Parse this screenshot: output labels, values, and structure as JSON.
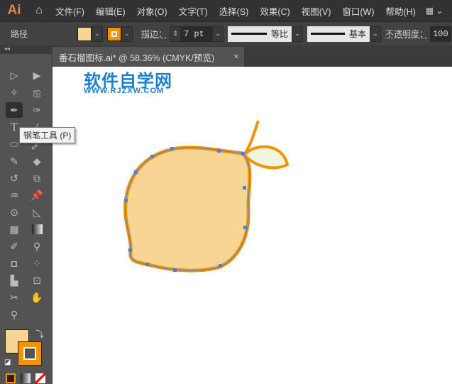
{
  "app": {
    "logo": "Ai",
    "home_icon": "home-icon"
  },
  "menu": [
    "文件(F)",
    "编辑(E)",
    "对象(O)",
    "文字(T)",
    "选择(S)",
    "效果(C)",
    "视图(V)",
    "窗口(W)",
    "帮助(H)"
  ],
  "control": {
    "selection_label": "路径",
    "fill_color": "#f7d594",
    "stroke_color": "#f29400",
    "stroke_label": "描边：",
    "stroke_weight": "7 pt",
    "profile_label": "等比",
    "brush_label": "基本",
    "opacity_label": "不透明度：",
    "opacity_value": "100"
  },
  "document_tab": {
    "title": "番石榴图标.ai* @ 58.36% (CMYK/预览)",
    "close": "×"
  },
  "tooltip": "钢笔工具 (P)",
  "watermark": {
    "title": "软件自学网",
    "url": "WWW.RJZXW.COM"
  },
  "colors": {
    "fill": "#f7d594",
    "stroke": "#f29400",
    "leaf": "#eef5e0",
    "anchor": "#4a7fe8"
  }
}
